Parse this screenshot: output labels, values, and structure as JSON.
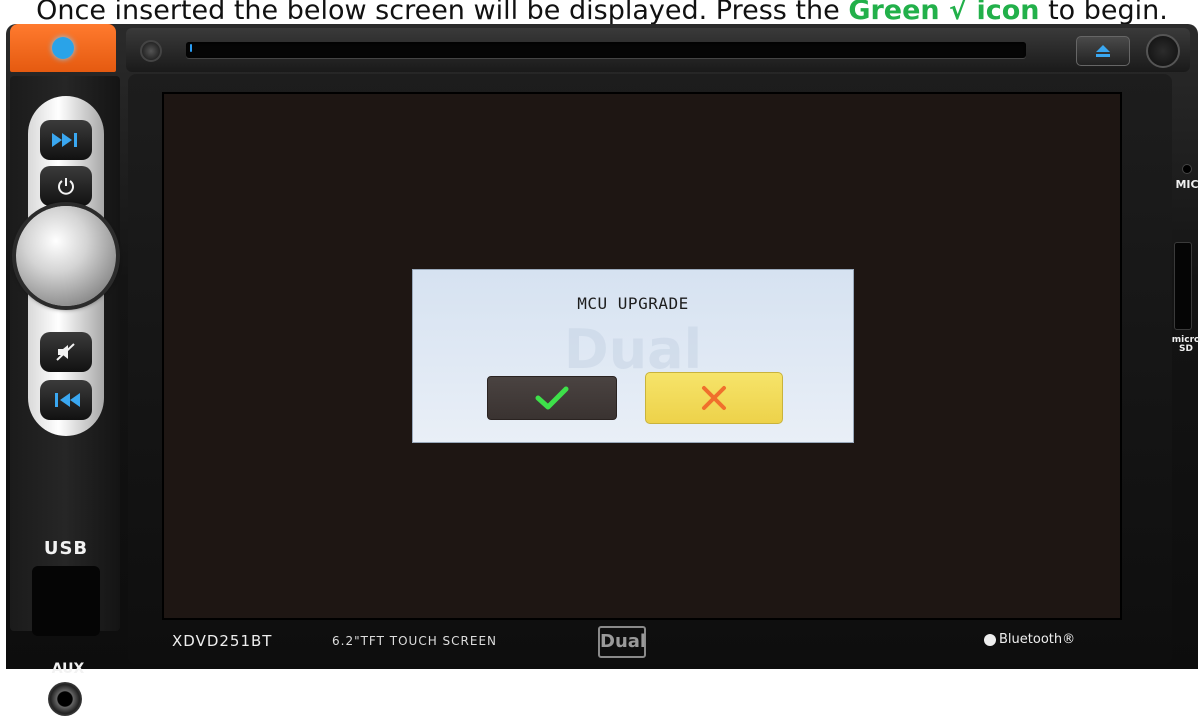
{
  "instruction": {
    "prefix": "Once inserted the below screen will be displayed. Press the ",
    "highlight": "Green √ icon",
    "suffix": " to begin."
  },
  "device": {
    "model": "XDVD251BT",
    "screen_spec": "6.2\"TFT TOUCH SCREEN",
    "brand": "Dual",
    "bluetooth": "Bluetooth®",
    "usb_label": "USB",
    "aux_label": "AUX",
    "mic_label": "MIC",
    "sd_label": "micro SD",
    "icons": {
      "voice": "microphone-icon",
      "eject": "eject-icon",
      "next": "skip-next-icon",
      "power": "power-icon",
      "mute": "mute-icon",
      "prev": "skip-previous-icon",
      "bluetooth": "bluetooth-icon"
    }
  },
  "dialog": {
    "title": "MCU UPGRADE",
    "watermark": "Dual",
    "confirm_icon": "checkmark-icon",
    "cancel_icon": "close-x-icon"
  },
  "colors": {
    "highlight_text": "#22b04a",
    "confirm_check": "#3ee04a",
    "cancel_x": "#f0702c",
    "cancel_bg": "#f2da56",
    "confirm_bg": "#423b39",
    "orange_button": "#f26a1f",
    "screen_bg": "#1e1613"
  }
}
